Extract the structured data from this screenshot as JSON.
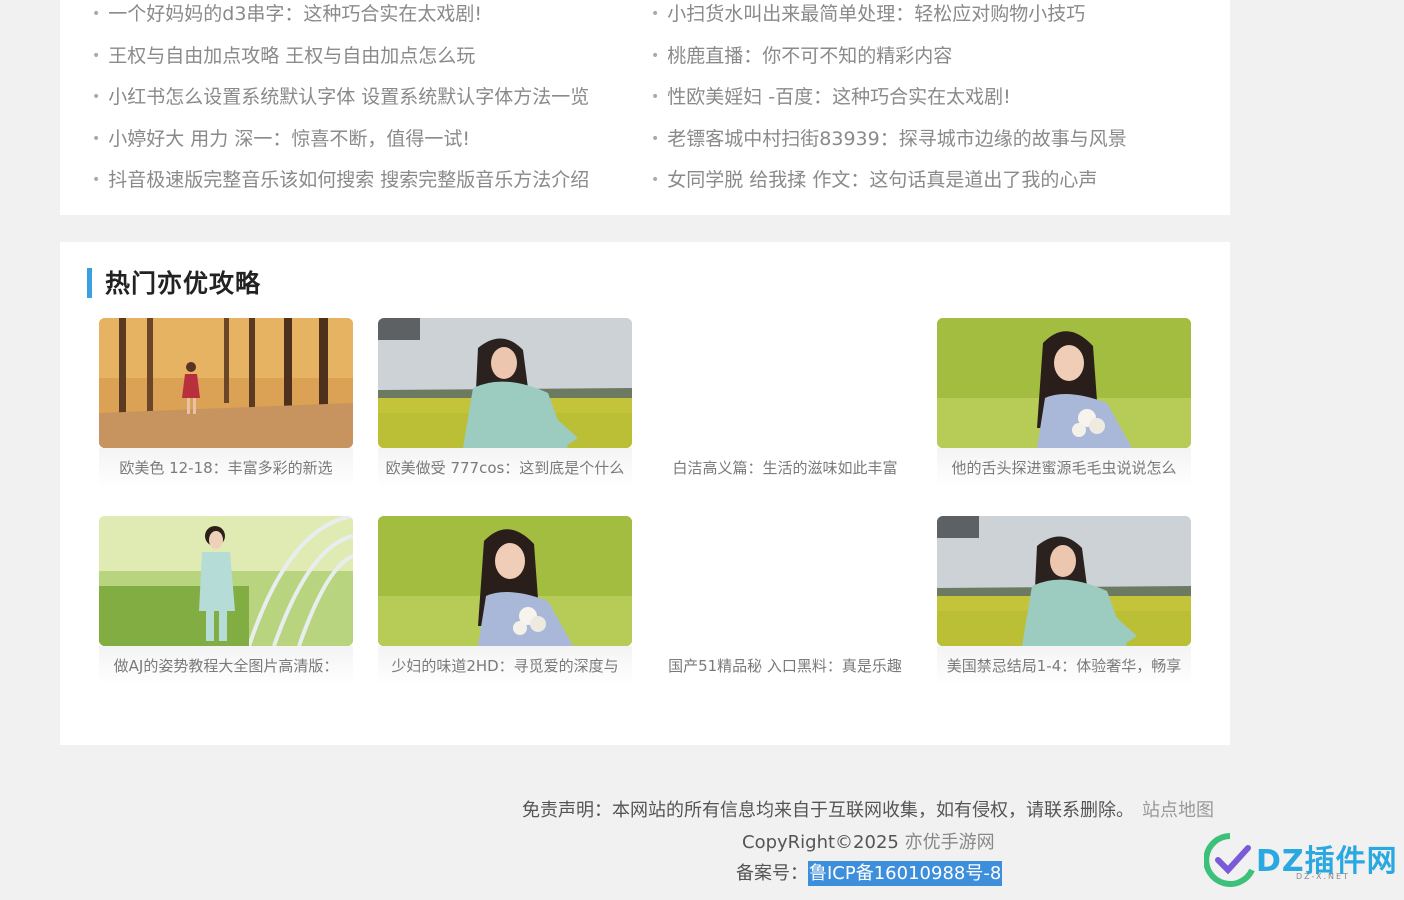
{
  "recent_links": {
    "left": [
      "一个好妈妈的d3串字：这种巧合实在太戏剧!",
      "王权与自由加点攻略 王权与自由加点怎么玩",
      "小红书怎么设置系统默认字体 设置系统默认字体方法一览",
      "小婷好大 用力 深一：惊喜不断，值得一试!",
      "抖音极速版完整音乐该如何搜索 搜索完整版音乐方法介绍"
    ],
    "right": [
      "小扫货水叫出来最简单处理：轻松应对购物小技巧",
      "桃鹿直播：你不可不知的精彩内容",
      "性欧美婬妇 -百度：这种巧合实在太戏剧!",
      "老镖客城中村扫街83939：探寻城市边缘的故事与风景",
      "女同学脱 给我揉 作文：这句话真是道出了我的心声"
    ]
  },
  "hot_section": {
    "title": "热门亦优攻略",
    "cards": [
      {
        "caption": "欧美色 12-18：丰富多彩的新选",
        "image": "autumn"
      },
      {
        "caption": "欧美做受 777cos：这到底是个什么",
        "image": "rapeseed"
      },
      {
        "caption": "白洁高义篇：生活的滋味如此丰富",
        "image": ""
      },
      {
        "caption": "他的舌头探进蜜源毛毛虫说说怎么",
        "image": "grass"
      },
      {
        "caption": "做AJ的姿势教程大全图片高清版：",
        "image": "tunnel"
      },
      {
        "caption": "少妇的味道2HD：寻觅爱的深度与",
        "image": "grass"
      },
      {
        "caption": "国产51精品秘 入口黑料：真是乐趣",
        "image": ""
      },
      {
        "caption": "美国禁忌结局1-4：体验奢华，畅享",
        "image": "rapeseed"
      }
    ]
  },
  "footer": {
    "disclaimer": "免责声明：本网站的所有信息均来自于互联网收集，如有侵权，请联系删除。",
    "sitemap": "站点地图",
    "copyright_prefix": "CopyRight©2025 ",
    "site_name": "亦优手游网",
    "icp_label": "备案号：",
    "icp_number": "鲁ICP备16010988号-8"
  },
  "watermark": {
    "text": "DZ插件网",
    "subtext": "DZ-X.NET"
  },
  "colors": {
    "accent": "#3aa0e0",
    "selection": "#3d8fdc",
    "page_bg": "#f1f1f1"
  }
}
